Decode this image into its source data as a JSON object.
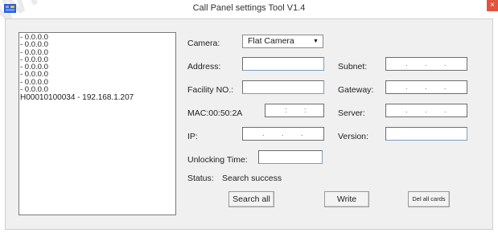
{
  "window": {
    "title": "Call Panel settings Tool V1.4",
    "close_glyph": "×"
  },
  "watermark_text": "W.W.",
  "device_list": [
    "- 0.0.0.0",
    "- 0.0.0.0",
    "- 0.0.0.0",
    "- 0.0.0.0",
    "- 0.0.0.0",
    "- 0.0.0.0",
    "- 0.0.0.0",
    "- 0.0.0.0",
    "H00010100034 - 192.168.1.207"
  ],
  "form": {
    "camera_label": "Camera:",
    "camera_value": "Flat Camera",
    "address_label": "Address:",
    "address_value": "",
    "subnet_label": "Subnet:",
    "facility_label": "Facility NO.:",
    "facility_value": "",
    "gateway_label": "Gateway:",
    "mac_label": "MAC:00:50:2A",
    "server_label": "Server:",
    "ip_label": "IP:",
    "version_label": "Version:",
    "version_value": "",
    "unlocking_label": "Unlocking  Time:",
    "unlocking_value": "",
    "status_label": "Status:",
    "status_value": "Search success",
    "ip_separator": ".",
    "mac_separator": ":"
  },
  "buttons": {
    "search_all": "Search all",
    "write": "Write",
    "del_all_cards": "Del all cards"
  },
  "icons": {
    "app": "app-window-icon",
    "dropdown": "chevron-down-icon"
  }
}
